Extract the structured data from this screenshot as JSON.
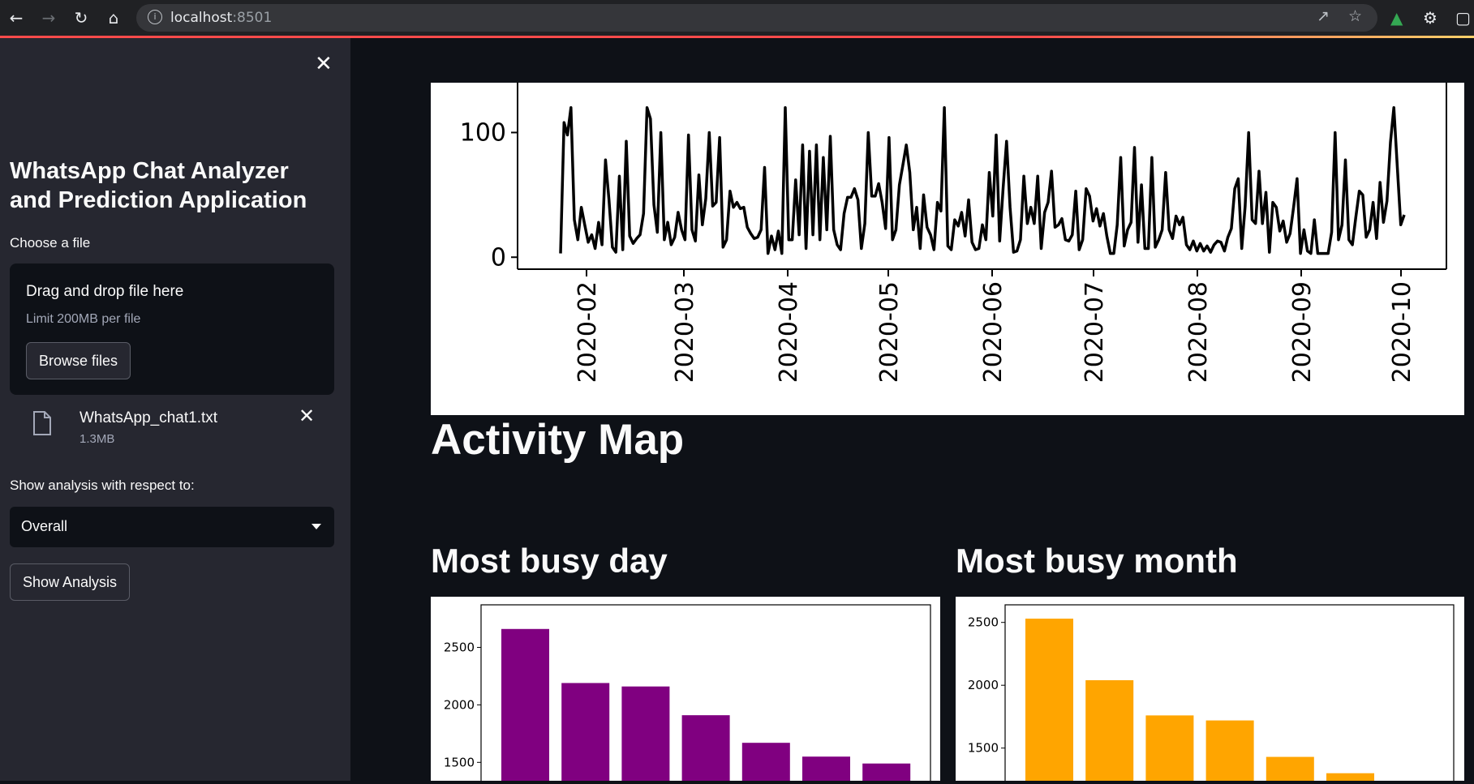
{
  "browser": {
    "url_host": "localhost",
    "url_port": ":8501"
  },
  "sidebar": {
    "title": "WhatsApp Chat Analyzer and Prediction Application",
    "file_label": "Choose a file",
    "dropzone_title": "Drag and drop file here",
    "dropzone_limit": "Limit 200MB per file",
    "browse_label": "Browse files",
    "file_name": "WhatsApp_chat1.txt",
    "file_size": "1.3MB",
    "analysis_label": "Show analysis with respect to:",
    "selected_option": "Overall",
    "show_button": "Show Analysis"
  },
  "main": {
    "activity_heading": "Activity Map",
    "busy_day_heading": "Most busy day",
    "busy_month_heading": "Most busy month"
  },
  "colors": {
    "day_bar": "#800080",
    "month_bar": "#ffa500",
    "accent": "#ff4b4b"
  },
  "chart_data": [
    {
      "type": "line",
      "x_ticks": [
        "2020-02",
        "2020-03",
        "2020-04",
        "2020-05",
        "2020-06",
        "2020-07",
        "2020-08",
        "2020-09",
        "2020-10"
      ],
      "y_ticks": [
        0,
        100
      ],
      "values": [
        3,
        108,
        98,
        120,
        30,
        14,
        40,
        26,
        12,
        18,
        7,
        28,
        10,
        78,
        46,
        8,
        4,
        65,
        6,
        93,
        17,
        11,
        15,
        18,
        35,
        120,
        111,
        42,
        20,
        100,
        14,
        28,
        10,
        16,
        36,
        22,
        14,
        98,
        22,
        13,
        66,
        26,
        47,
        100,
        41,
        44,
        96,
        8,
        14,
        53,
        40,
        44,
        39,
        40,
        24,
        19,
        15,
        16,
        22,
        72,
        3,
        17,
        6,
        21,
        3,
        120,
        14,
        14,
        62,
        18,
        90,
        7,
        85,
        18,
        90,
        14,
        80,
        22,
        97,
        22,
        10,
        6,
        35,
        48,
        48,
        55,
        46,
        7,
        27,
        100,
        49,
        49,
        59,
        44,
        23,
        96,
        14,
        22,
        58,
        74,
        90,
        68,
        22,
        40,
        7,
        50,
        24,
        18,
        6,
        44,
        37,
        120,
        9,
        6,
        30,
        25,
        36,
        17,
        46,
        12,
        6,
        7,
        26,
        14,
        68,
        33,
        98,
        13,
        56,
        93,
        40,
        4,
        5,
        14,
        65,
        27,
        40,
        27,
        65,
        7,
        36,
        44,
        69,
        24,
        26,
        31,
        14,
        13,
        18,
        53,
        6,
        14,
        55,
        49,
        29,
        39,
        25,
        35,
        17,
        3,
        3,
        26,
        80,
        9,
        22,
        28,
        88,
        12,
        58,
        7,
        7,
        80,
        8,
        14,
        22,
        68,
        22,
        15,
        33,
        26,
        32,
        10,
        6,
        13,
        5,
        11,
        5,
        9,
        4,
        10,
        13,
        12,
        5,
        16,
        23,
        55,
        63,
        7,
        41,
        100,
        30,
        27,
        69,
        27,
        52,
        4,
        44,
        40,
        21,
        29,
        12,
        19,
        40,
        63,
        3,
        22,
        5,
        3,
        30,
        3,
        3,
        3,
        3,
        20,
        100,
        14,
        26,
        78,
        14,
        10,
        32,
        53,
        50,
        16,
        22,
        44,
        15,
        60,
        28,
        45,
        92,
        120,
        72,
        26,
        34
      ],
      "ylim": [
        -25,
        125
      ]
    },
    {
      "type": "bar",
      "values": [
        2660,
        2190,
        2160,
        1910,
        1670,
        1550,
        1490
      ],
      "y_ticks": [
        1500,
        2000,
        2500
      ],
      "ylim": [
        1340,
        2870
      ]
    },
    {
      "type": "bar",
      "values": [
        2530,
        2040,
        1760,
        1720,
        1430,
        1300
      ],
      "y_ticks": [
        1500,
        2000,
        2500
      ],
      "ylim": [
        1240,
        2640
      ]
    }
  ]
}
